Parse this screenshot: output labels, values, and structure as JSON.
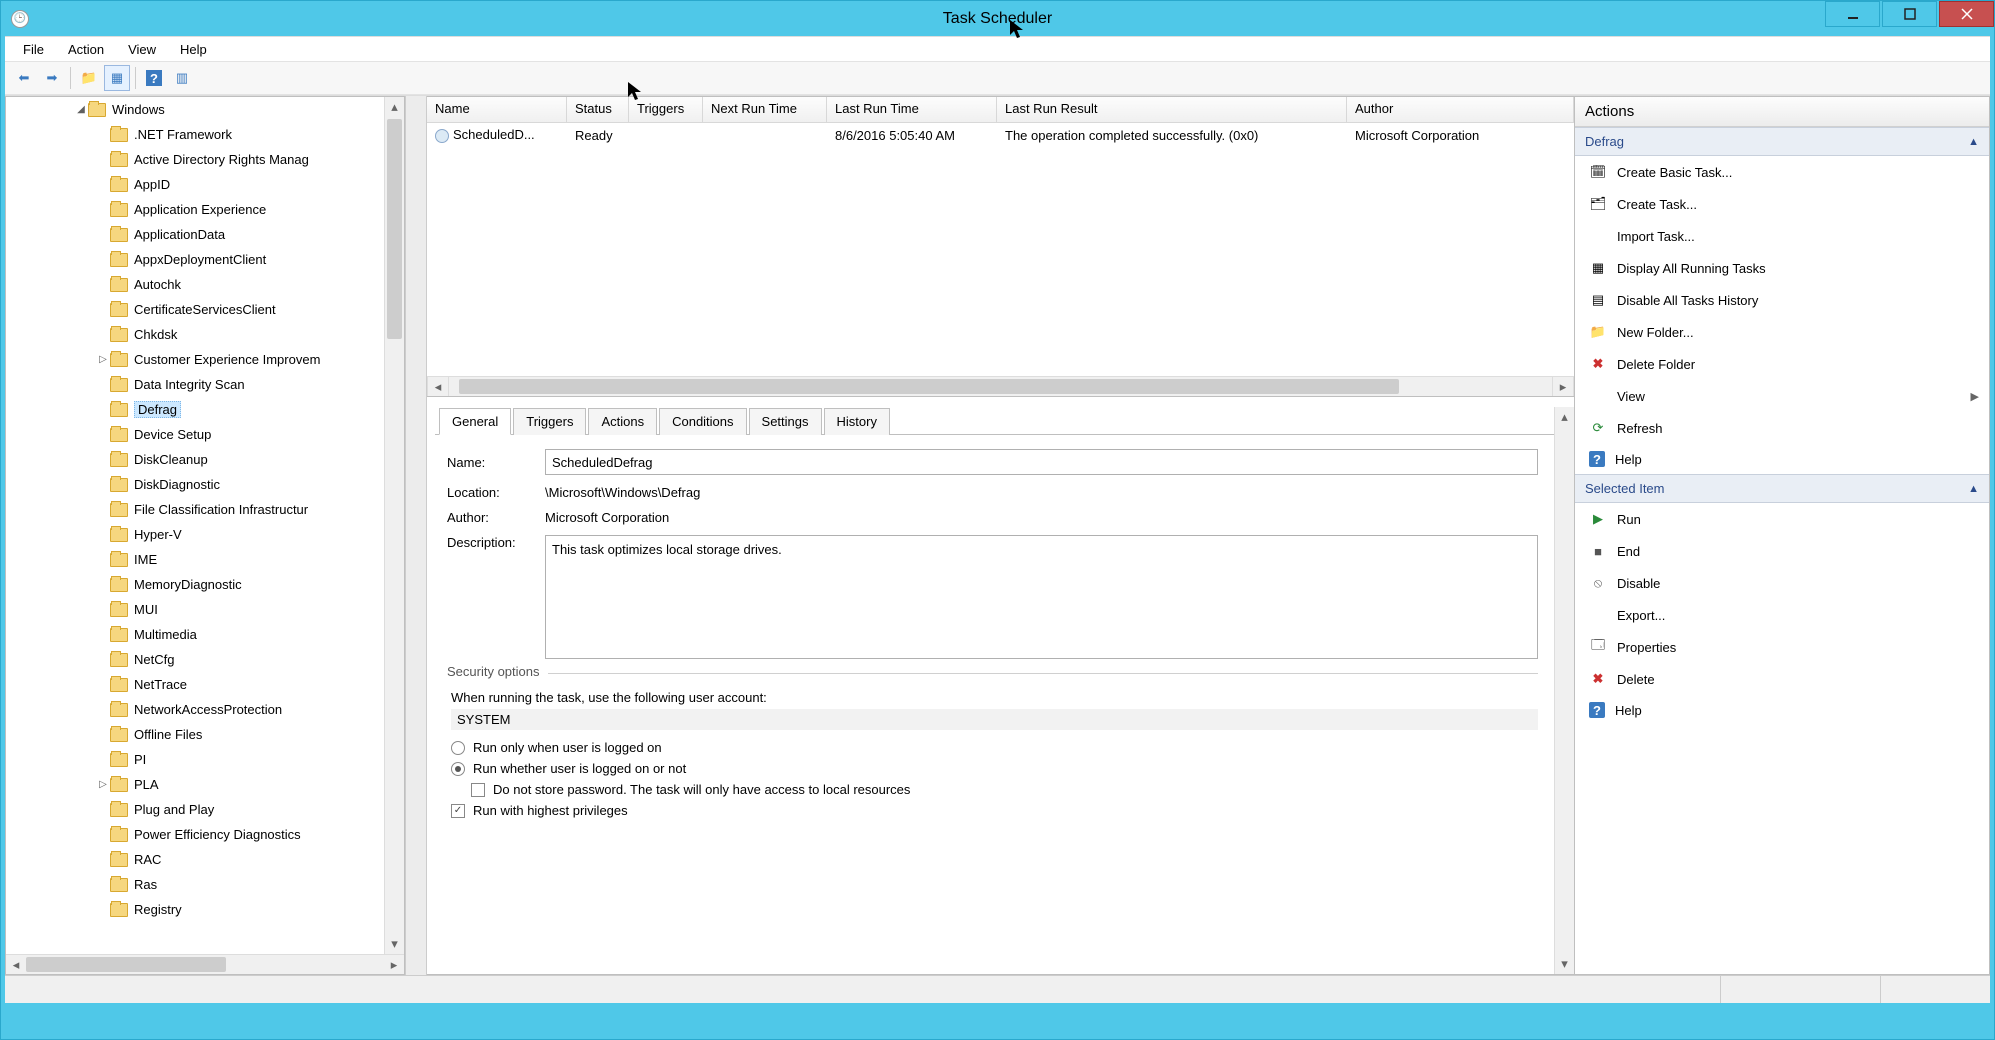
{
  "window": {
    "title": "Task Scheduler"
  },
  "menu": {
    "file": "File",
    "action": "Action",
    "view": "View",
    "help": "Help"
  },
  "tree": {
    "root": {
      "label": "Windows",
      "expanded": true
    },
    "items": [
      {
        "label": ".NET Framework"
      },
      {
        "label": "Active Directory Rights Manag"
      },
      {
        "label": "AppID"
      },
      {
        "label": "Application Experience"
      },
      {
        "label": "ApplicationData"
      },
      {
        "label": "AppxDeploymentClient"
      },
      {
        "label": "Autochk"
      },
      {
        "label": "CertificateServicesClient"
      },
      {
        "label": "Chkdsk"
      },
      {
        "label": "Customer Experience Improvem",
        "hasChildren": true
      },
      {
        "label": "Data Integrity Scan"
      },
      {
        "label": "Defrag",
        "selected": true
      },
      {
        "label": "Device Setup"
      },
      {
        "label": "DiskCleanup"
      },
      {
        "label": "DiskDiagnostic"
      },
      {
        "label": "File Classification Infrastructur"
      },
      {
        "label": "Hyper-V"
      },
      {
        "label": "IME"
      },
      {
        "label": "MemoryDiagnostic"
      },
      {
        "label": "MUI"
      },
      {
        "label": "Multimedia"
      },
      {
        "label": "NetCfg"
      },
      {
        "label": "NetTrace"
      },
      {
        "label": "NetworkAccessProtection"
      },
      {
        "label": "Offline Files"
      },
      {
        "label": "PI"
      },
      {
        "label": "PLA",
        "hasChildren": true
      },
      {
        "label": "Plug and Play"
      },
      {
        "label": "Power Efficiency Diagnostics"
      },
      {
        "label": "RAC"
      },
      {
        "label": "Ras"
      },
      {
        "label": "Registry"
      }
    ]
  },
  "taskList": {
    "columns": {
      "name": "Name",
      "status": "Status",
      "triggers": "Triggers",
      "nextRun": "Next Run Time",
      "lastRun": "Last Run Time",
      "lastResult": "Last Run Result",
      "author": "Author"
    },
    "row": {
      "name": "ScheduledD...",
      "status": "Ready",
      "triggers": "",
      "nextRun": "",
      "lastRun": "8/6/2016 5:05:40 AM",
      "lastResult": "The operation completed successfully. (0x0)",
      "author": "Microsoft Corporation"
    }
  },
  "tabs": {
    "general": "General",
    "triggers": "Triggers",
    "actions": "Actions",
    "conditions": "Conditions",
    "settings": "Settings",
    "history": "History"
  },
  "general": {
    "nameLabel": "Name:",
    "name": "ScheduledDefrag",
    "locationLabel": "Location:",
    "location": "\\Microsoft\\Windows\\Defrag",
    "authorLabel": "Author:",
    "author": "Microsoft Corporation",
    "descLabel": "Description:",
    "description": "This task optimizes local storage drives.",
    "securityLegend": "Security options",
    "securityPrompt": "When running the task, use the following user account:",
    "userAccount": "SYSTEM",
    "radioLoggedOn": "Run only when user is logged on",
    "radioLoggedOff": "Run whether user is logged on or not",
    "chkNoPwd": "Do not store password.  The task will only have access to local resources",
    "chkHighest": "Run with highest privileges"
  },
  "actions": {
    "heading": "Actions",
    "section1": "Defrag",
    "createBasic": "Create Basic Task...",
    "createTask": "Create Task...",
    "importTask": "Import Task...",
    "displayRunning": "Display All Running Tasks",
    "disableHistory": "Disable All Tasks History",
    "newFolder": "New Folder...",
    "deleteFolder": "Delete Folder",
    "viewItem": "View",
    "refresh": "Refresh",
    "help1": "Help",
    "section2": "Selected Item",
    "run": "Run",
    "end": "End",
    "disable": "Disable",
    "export": "Export...",
    "properties": "Properties",
    "delete": "Delete",
    "help2": "Help"
  }
}
